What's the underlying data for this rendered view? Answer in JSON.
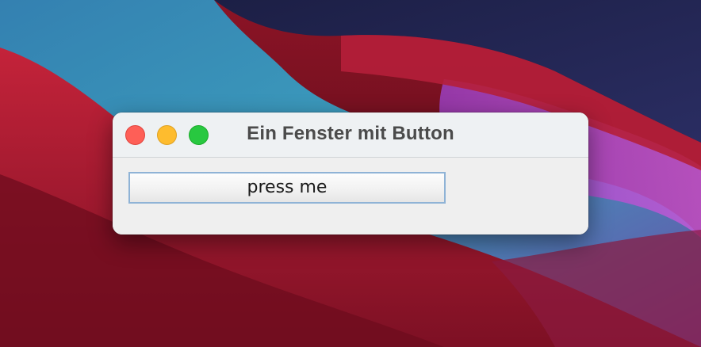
{
  "window": {
    "title": "Ein Fenster mit Button"
  },
  "main": {
    "button_label": "press me"
  },
  "colors": {
    "traffic_close": "#fe5f57",
    "traffic_minimize": "#febc2e",
    "traffic_maximize": "#28c840",
    "button_border": "#8fb3d6",
    "titlebar_bg": "#eef1f3",
    "window_bg": "#efefef"
  }
}
